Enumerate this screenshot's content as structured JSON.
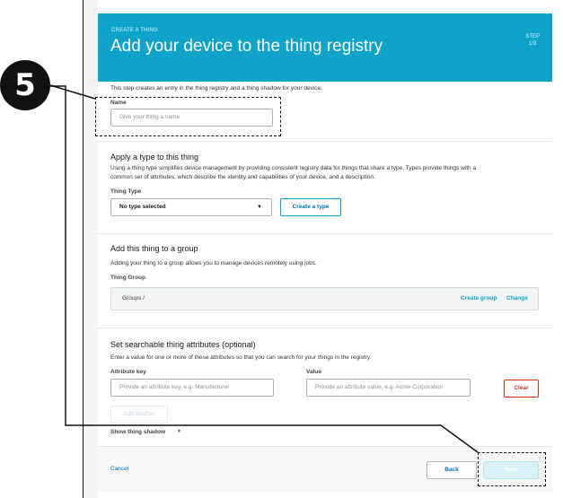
{
  "banner": {
    "eyebrow": "CREATE A THING",
    "title": "Add your device to the thing registry",
    "step_label": "STEP",
    "step_value": "1/3"
  },
  "intro": {
    "text": "This step creates an entry in the thing registry and a thing shadow for your device.",
    "name_label": "Name",
    "name_placeholder": "Give your thing a name"
  },
  "type_section": {
    "heading": "Apply a type to this thing",
    "description_1": "Using a thing type simplifies device management by providing consistent registry data for things that share a type. Types provide things with a",
    "description_2": "common set of attributes, which describe the identity and capabilities of your device, and a description.",
    "field_label": "Thing Type",
    "selected": "No type selected",
    "create_button": "Create a type"
  },
  "group_section": {
    "heading": "Add this thing to a group",
    "description": "Adding your thing to a group allows you to manage devices remotely using jobs.",
    "field_label": "Thing Group",
    "path": "Groups /",
    "create_link": "Create group",
    "change_link": "Change"
  },
  "attributes_section": {
    "heading": "Set searchable thing attributes (optional)",
    "description": "Enter a value for one or more of these attributes so that you can search for your things in the registry.",
    "key_label": "Attribute key",
    "value_label": "Value",
    "key_placeholder": "Provide an attribute key, e.g. Manufacturer",
    "value_placeholder": "Provide an attribute value, e.g. Acme-Corporation",
    "clear_button": "Clear",
    "add_button": "Add another"
  },
  "shadow": {
    "label": "Show thing shadow"
  },
  "footer": {
    "cancel": "Cancel",
    "back": "Back",
    "next": "Next"
  },
  "callout": {
    "number": "5"
  }
}
